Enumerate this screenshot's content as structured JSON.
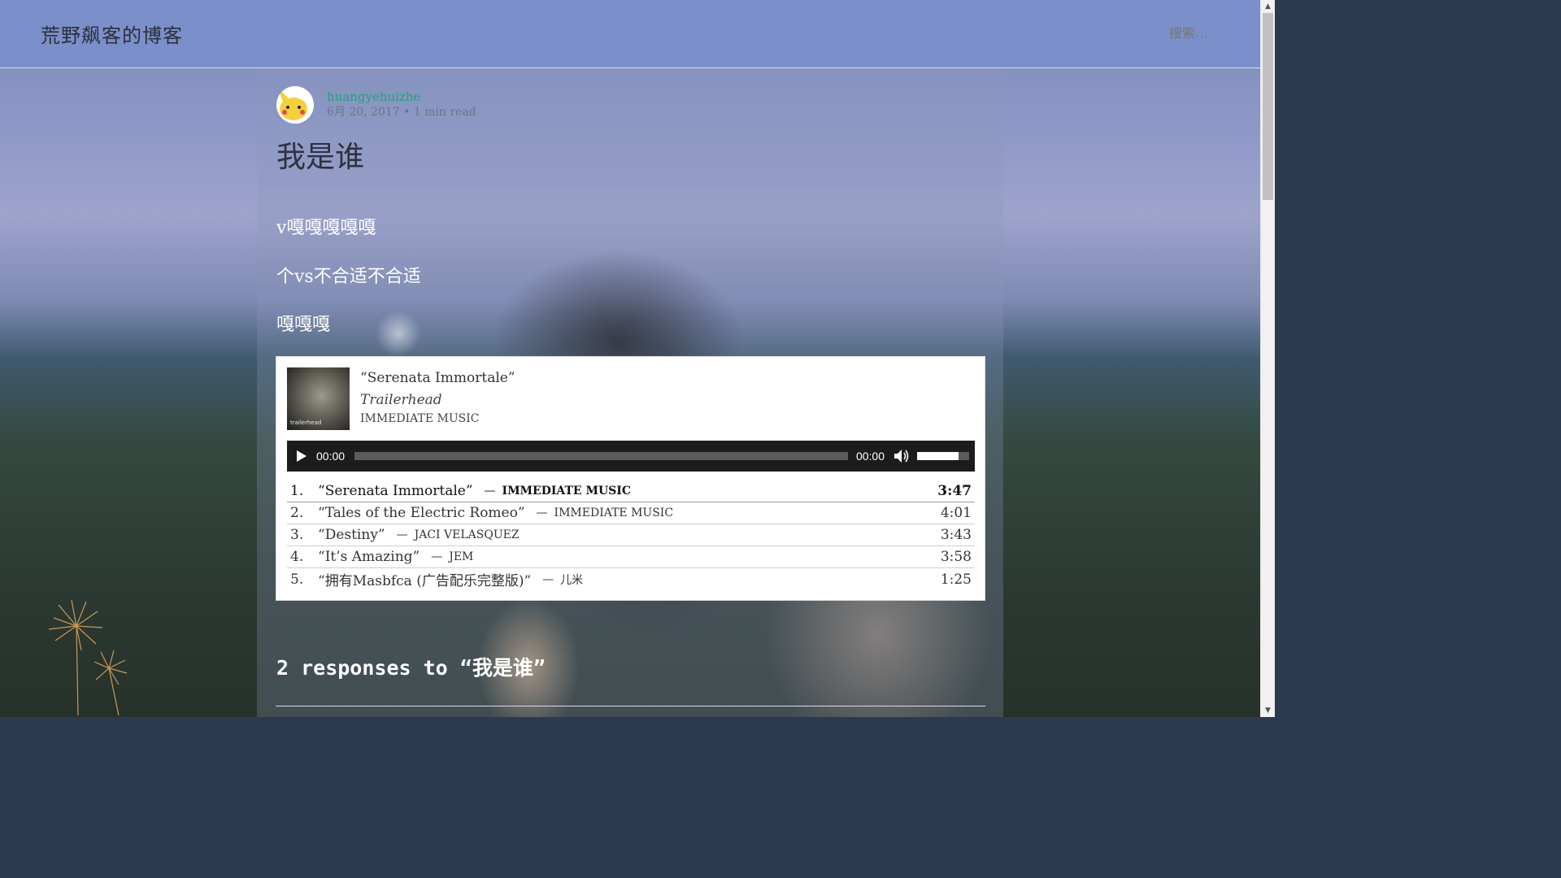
{
  "header": {
    "site_title": "荒野飙客的博客",
    "search_placeholder": "搜索…"
  },
  "post": {
    "author": "huangyehuizhe",
    "date_line": "6月 20, 2017 • 1 min read",
    "title": "我是谁",
    "paragraphs": [
      "v嘎嘎嘎嘎嘎",
      "个vs不合适不合适",
      "嘎嘎嘎"
    ]
  },
  "player": {
    "cover_label": "trailerhead",
    "now_playing": {
      "title": "“Serenata Immortale”",
      "album": "Trailerhead",
      "artist": "IMMEDIATE MUSIC"
    },
    "controls": {
      "current_time": "00:00",
      "duration": "00:00",
      "progress": 0.0,
      "volume": 0.8
    },
    "playlist": [
      {
        "num": "1.",
        "title": "“Serenata Immortale”",
        "sep": "—",
        "artist": "IMMEDIATE MUSIC",
        "duration": "3:47"
      },
      {
        "num": "2.",
        "title": "“Tales of the Electric Romeo”",
        "sep": "—",
        "artist": "IMMEDIATE MUSIC",
        "duration": "4:01"
      },
      {
        "num": "3.",
        "title": "“Destiny”",
        "sep": "—",
        "artist": "JACI VELASQUEZ",
        "duration": "3:43"
      },
      {
        "num": "4.",
        "title": "“It’s Amazing”",
        "sep": "—",
        "artist": "JEM",
        "duration": "3:58"
      },
      {
        "num": "5.",
        "title": "“拥有Masbfca (广告配乐完整版)”",
        "sep": "—",
        "artist": "儿米",
        "duration": "1:25"
      }
    ]
  },
  "comments": {
    "heading": "2 responses to “我是谁”"
  },
  "colors": {
    "header_bg": "#7b8fca",
    "author_link": "#1fa37a",
    "player_controls_bg": "#1c1c1c"
  },
  "icons": {
    "play": "play-icon",
    "volume": "volume-icon",
    "scroll_up": "arrow-up-icon",
    "scroll_down": "arrow-down-icon"
  }
}
